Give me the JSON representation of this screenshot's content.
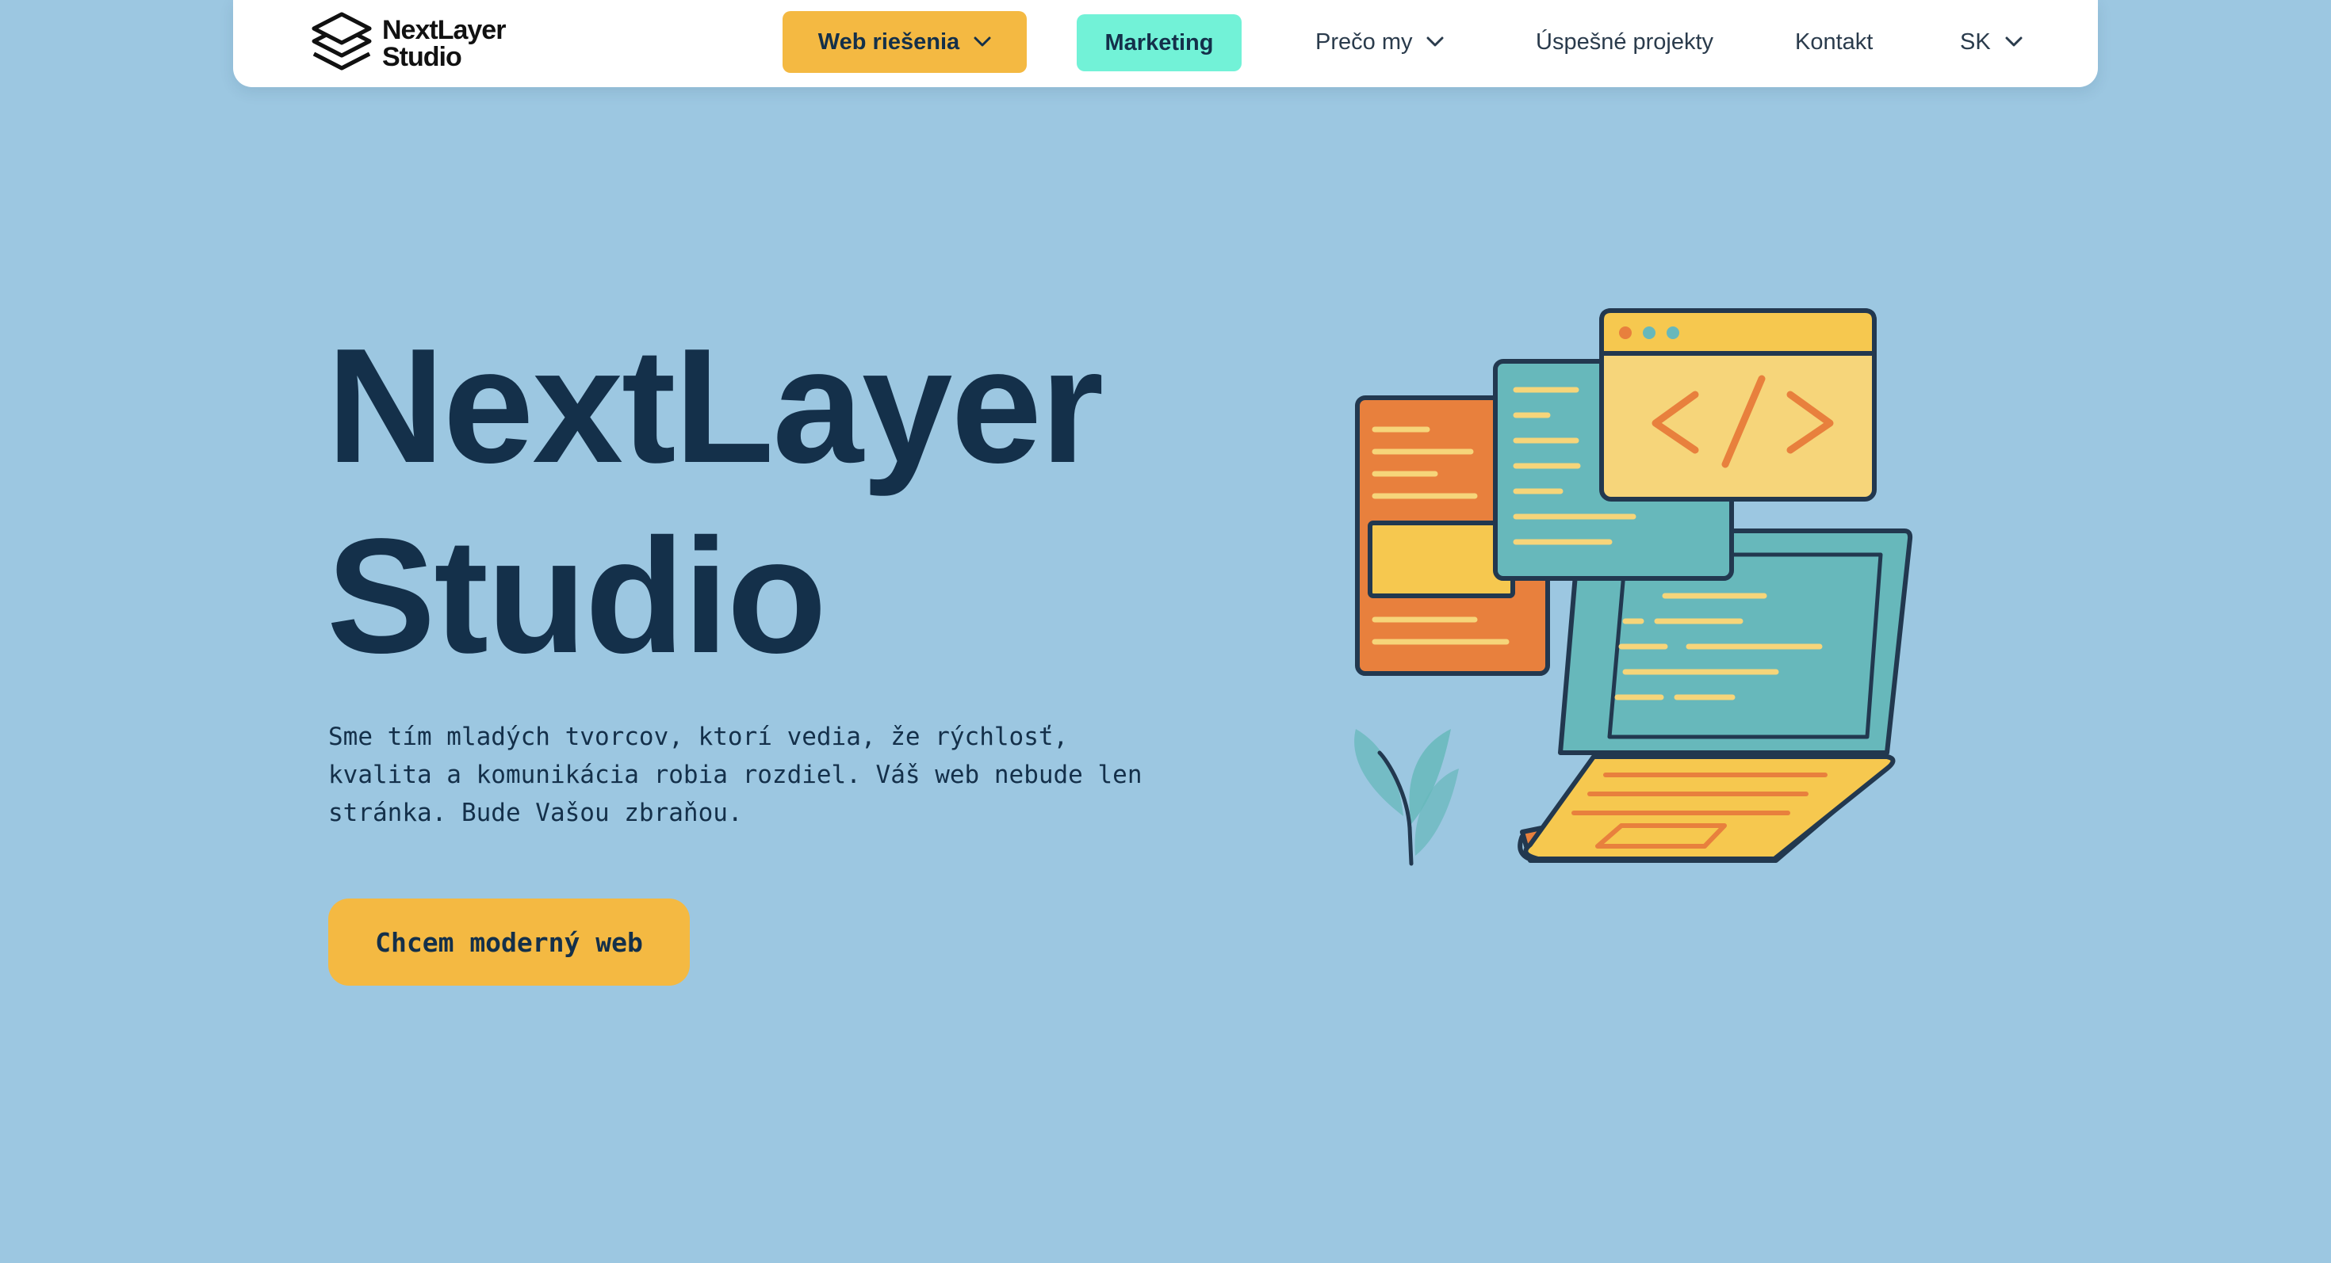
{
  "brand": {
    "line1": "NextLayer",
    "line2": "Studio"
  },
  "nav": {
    "web_solutions": "Web riešenia",
    "marketing": "Marketing",
    "why_us": "Prečo my",
    "projects": "Úspešné projekty",
    "contact": "Kontakt",
    "language": "SK"
  },
  "hero": {
    "title_line1": "NextLayer",
    "title_line2": "Studio",
    "subtitle_line1": "Sme tím mladých tvorcov, ktorí vedia, že rýchlosť,",
    "subtitle_line2": "kvalita a komunikácia robia rozdiel. Váš web nebude len",
    "subtitle_line3": "stránka. Bude Vašou zbraňou.",
    "cta": "Chcem moderný web"
  },
  "colors": {
    "background": "#9cc7e1",
    "navbar": "#ffffff",
    "accent_yellow": "#f4b942",
    "accent_mint": "#72f2d7",
    "text_dark": "#14304a",
    "illus_orange": "#e8803d",
    "illus_teal": "#67b8bb",
    "illus_yellow": "#f6d57a"
  },
  "icons": {
    "logo": "layers-icon",
    "dropdown": "chevron-down-icon",
    "illustration": "laptop-code-illustration"
  }
}
